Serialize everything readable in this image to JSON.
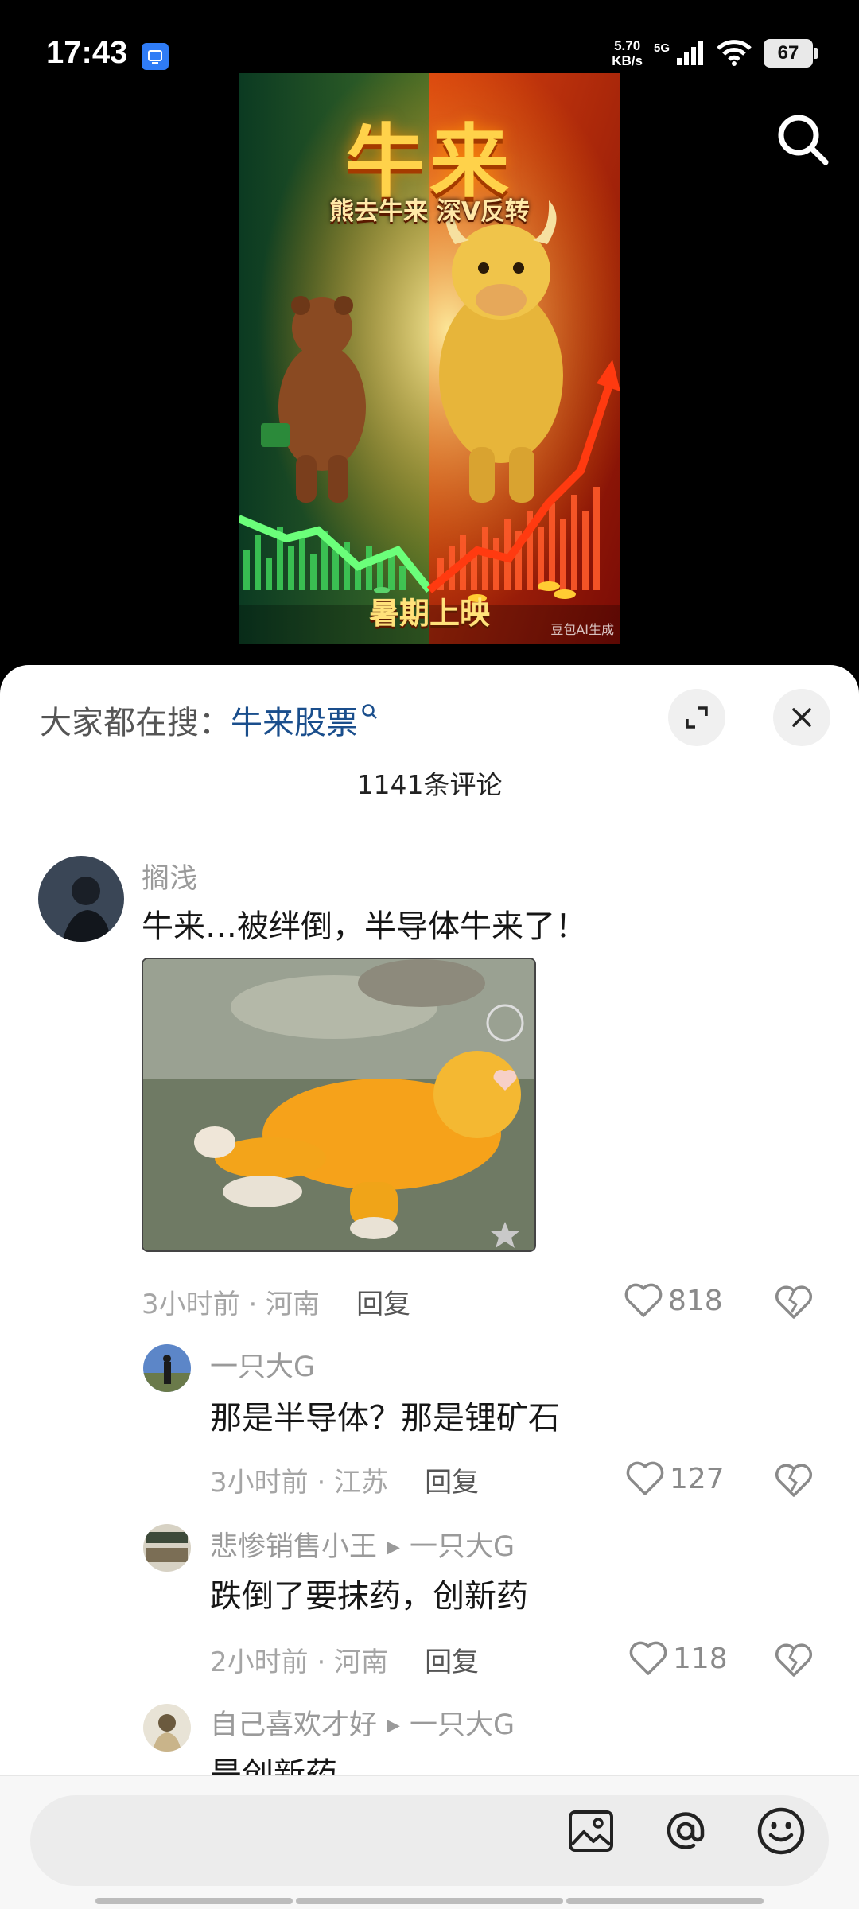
{
  "status_bar": {
    "time": "17:43",
    "net_speed_value": "5.70",
    "net_speed_unit": "KB/s",
    "network_type": "5G",
    "battery": "67"
  },
  "poster": {
    "title": "牛来",
    "subtitle": "熊去牛来 深V反转",
    "bottom_text": "暑期上映",
    "watermark": "豆包AI生成"
  },
  "comment_sheet": {
    "trending_label": "大家都在搜：",
    "trending_term": "牛来股票",
    "comment_count": "1141条评论",
    "comments": [
      {
        "user": "搁浅",
        "text": "牛来…被绊倒，半导体牛来了！",
        "time": "3小时前 · 河南",
        "reply": "回复",
        "likes": "818"
      },
      {
        "user": "一只大G",
        "text": "那是半导体？那是锂矿石",
        "time": "3小时前 · 江苏",
        "reply": "回复",
        "likes": "127"
      },
      {
        "user": "悲惨销售小王",
        "reply_to": "一只大G",
        "text": "跌倒了要抹药，创新药",
        "time": "2小时前 · 河南",
        "reply": "回复",
        "likes": "118"
      },
      {
        "user": "自己喜欢才好",
        "reply_to": "一只大G",
        "text": "是创新药"
      }
    ]
  },
  "colors": {
    "trending_term": "#1a4e8c",
    "meta": "#a5a5a5",
    "sheet_bg": "#ffffff"
  },
  "icons": [
    "search-icon",
    "expand-icon",
    "close-icon",
    "heart-icon",
    "broken-heart-icon",
    "image-icon",
    "at-icon",
    "emoji-icon"
  ]
}
